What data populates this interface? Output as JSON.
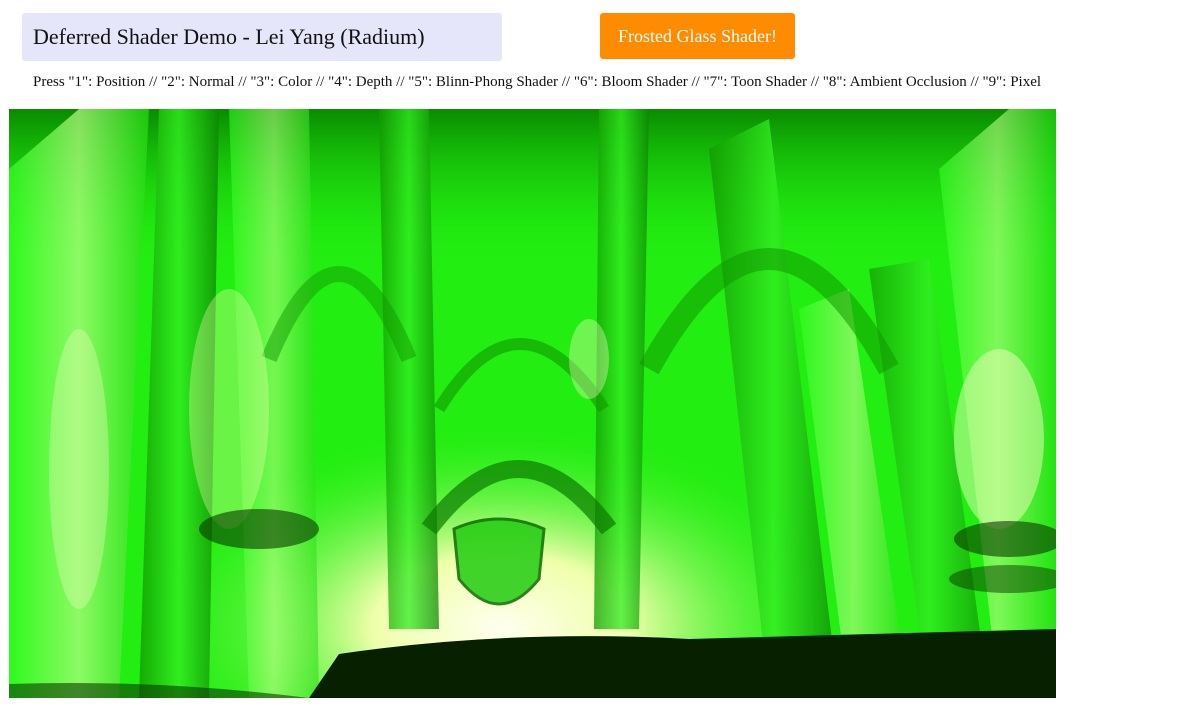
{
  "header": {
    "title": "Deferred Shader Demo - Lei Yang (Radium)",
    "shader_button_label": "Frosted Glass Shader!"
  },
  "instructions": {
    "text": "Press \"1\": Position // \"2\": Normal // \"3\": Color // \"4\": Depth // \"5\": Blinn-Phong Shader // \"6\": Bloom Shader // \"7\": Toon Shader // \"8\": Ambient Occlusion // \"9\": Pixel"
  },
  "colors": {
    "title_background": "#e6e6fa",
    "button_background": "#ff8c00",
    "button_text": "#ffffff",
    "render_green": "#22ee11",
    "render_dark": "#0a2a00",
    "render_highlight": "#ffffcc"
  }
}
